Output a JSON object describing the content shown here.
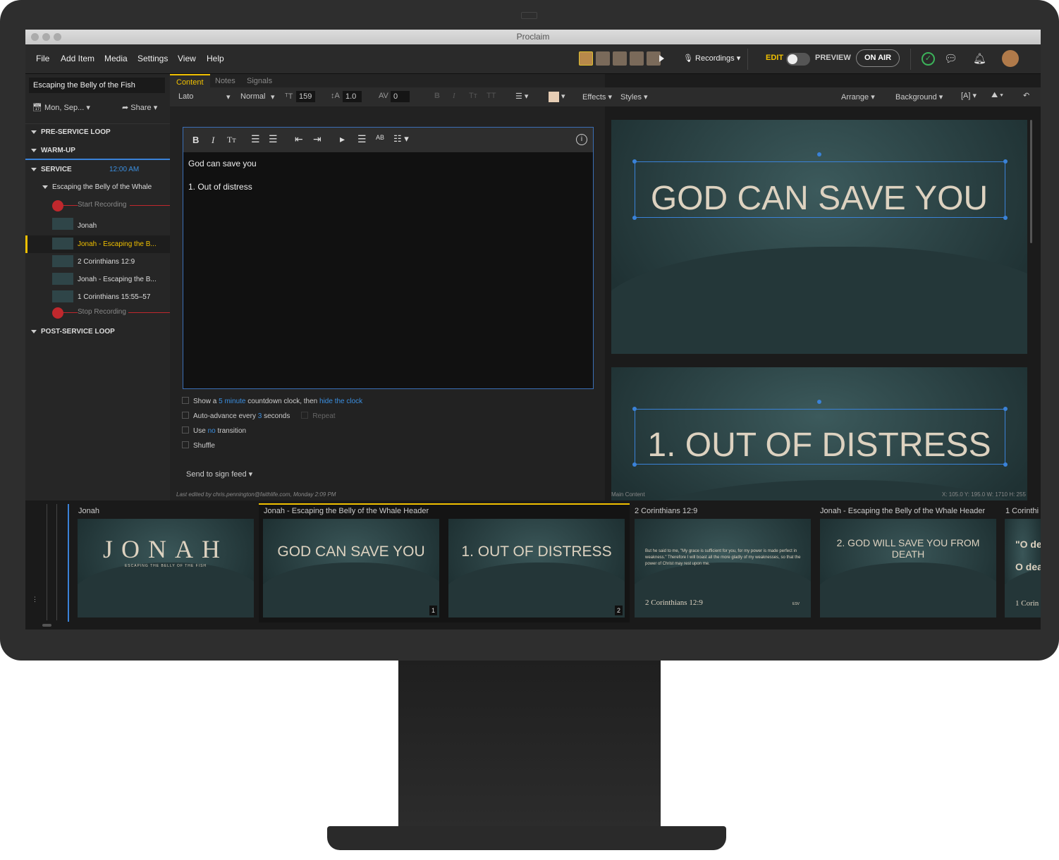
{
  "app": {
    "title": "Proclaim"
  },
  "menu": {
    "file": "File",
    "add_item": "Add Item",
    "media": "Media",
    "settings": "Settings",
    "view": "View",
    "help": "Help",
    "recordings": "Recordings",
    "edit": "EDIT",
    "preview": "PREVIEW",
    "on_air": "ON AIR"
  },
  "sidebar": {
    "presentation_title": "Escaping the Belly of the Fish",
    "date": "Mon, Sep...",
    "share": "Share",
    "sections": {
      "pre_service": "PRE-SERVICE LOOP",
      "warm_up": "WARM-UP",
      "service": "SERVICE",
      "service_time": "12:00 AM",
      "post_service": "POST-SERVICE LOOP"
    },
    "group": "Escaping the Belly of the Whale",
    "items": [
      "Start Recording",
      "Jonah",
      "Jonah - Escaping the B...",
      "2 Corinthians 12:9",
      "Jonah - Escaping the B...",
      "1 Corinthians 15:55–57",
      "Stop Recording"
    ]
  },
  "tabs": {
    "content": "Content",
    "notes": "Notes",
    "signals": "Signals"
  },
  "toolbar": {
    "font": "Lato",
    "weight": "Normal",
    "size": "159",
    "line_height": "1.0",
    "spacing": "0",
    "effects": "Effects",
    "styles": "Styles",
    "arrange": "Arrange",
    "background": "Background",
    "swatch": "#e6cdb4"
  },
  "editor": {
    "line1": "God can save you",
    "line2": "1. Out of distress"
  },
  "options": {
    "show_a": "Show a",
    "minute_link": "5 minute",
    "countdown": "countdown clock, then",
    "hide_link": "hide the clock",
    "auto_adv": "Auto-advance every",
    "seconds_link": "3",
    "seconds": "seconds",
    "repeat": "Repeat",
    "use": "Use",
    "no_link": "no",
    "transition": "transition",
    "shuffle": "Shuffle",
    "send": "Send to sign feed"
  },
  "status": {
    "last_edited": "Last edited by chris.pennington@faithlife.com, Monday 2:09 PM",
    "main_content": "Main Content",
    "coords": "X: 105.0  Y: 195.0   W: 1710  H: 255"
  },
  "preview": {
    "slide1": "GOD CAN SAVE YOU",
    "slide2": "1. OUT OF DISTRESS"
  },
  "strip": {
    "labels": [
      "Jonah",
      "Jonah - Escaping the Belly of the Whale Header",
      "2 Corinthians 12:9",
      "Jonah - Escaping the Belly of the Whale Header",
      "1 Corinthi"
    ],
    "jonah_title": "JONAH",
    "jonah_sub": "ESCAPING THE BELLY OF THE FISH",
    "t1": "GOD CAN SAVE YOU",
    "t1_num": "1",
    "t2": "1. OUT OF DISTRESS",
    "t2_num": "2",
    "verse": "But he said to me, \"My grace is sufficient for you, for my power is made perfect in weakness.\" Therefore I will boast all the more gladly of my weaknesses, so that the power of Christ may rest upon me.",
    "verse_ref": "2 Corinthians 12:9",
    "verse_ver": "ESV",
    "t4": "2. GOD WILL SAVE YOU FROM DEATH",
    "t5a": "\"O de",
    "t5b": "O dea",
    "t5c": "1 Corin"
  }
}
